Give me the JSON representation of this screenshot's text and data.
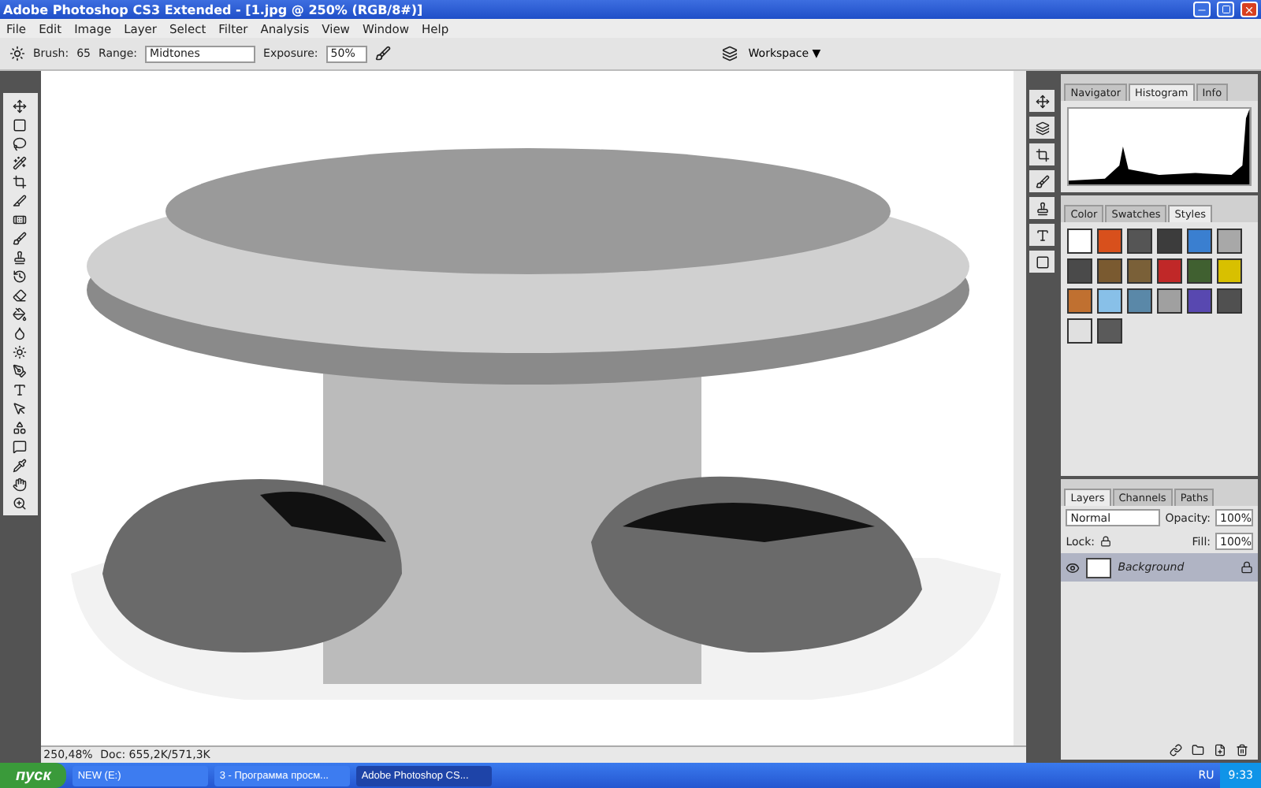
{
  "window": {
    "title": "Adobe Photoshop CS3 Extended - [1.jpg @ 250% (RGB/8#)]"
  },
  "menu": [
    "File",
    "Edit",
    "Image",
    "Layer",
    "Select",
    "Filter",
    "Analysis",
    "View",
    "Window",
    "Help"
  ],
  "options_bar": {
    "brush_label": "Brush:",
    "brush_size": "65",
    "range_label": "Range:",
    "range": "Midtones",
    "exposure_label": "Exposure:",
    "exposure": "50%",
    "workspace": "Workspace ▼"
  },
  "panels": [
    {
      "tabs": [
        {
          "label": "Navigator",
          "selected": false
        },
        {
          "label": "Histogram",
          "selected": true
        },
        {
          "label": "Info",
          "selected": false
        }
      ],
      "kind": "histogram"
    },
    {
      "tabs": [
        {
          "label": "Color",
          "selected": false
        },
        {
          "label": "Swatches",
          "selected": false
        },
        {
          "label": "Styles",
          "selected": true
        }
      ],
      "kind": "styles",
      "styles": [
        {
          "color": "#ffffff"
        },
        {
          "color": "#d8501c"
        },
        {
          "color": "#555555"
        },
        {
          "color": "#3c3c3c"
        },
        {
          "color": "#3a7fd0"
        },
        {
          "color": "#a8a8a8"
        },
        {
          "color": "#4a4a4a"
        },
        {
          "color": "#7a5a30"
        },
        {
          "color": "#7a6038"
        },
        {
          "color": "#c02828"
        },
        {
          "color": "#406030"
        },
        {
          "color": "#d8c000"
        },
        {
          "color": "#c07030"
        },
        {
          "color": "#88c0e8"
        },
        {
          "color": "#5a88a8"
        },
        {
          "color": "#a0a0a0"
        },
        {
          "color": "#5848b0"
        },
        {
          "color": "#505050"
        },
        {
          "color": "#e0e0e0"
        },
        {
          "color": "#5a5a5a"
        }
      ]
    },
    {
      "tabs": [
        {
          "label": "Layers",
          "selected": true
        },
        {
          "label": "Channels",
          "selected": false
        },
        {
          "label": "Paths",
          "selected": false
        }
      ],
      "kind": "layers",
      "blend_mode": "Normal",
      "opacity_label": "Opacity:",
      "opacity": "100%",
      "lock_label": "Lock:",
      "fill_label": "Fill:",
      "fill": "100%",
      "layers": [
        {
          "name": "Background",
          "visible": true,
          "selected": true,
          "locked": true
        }
      ]
    }
  ],
  "status_bar": {
    "zoom": "250,48%",
    "doc": "Doc: 655,2K/571,3K"
  },
  "taskbar": {
    "start": "пуск",
    "tasks": [
      {
        "label": "NEW (E:)",
        "selected": false
      },
      {
        "label": "3 - Программа просм...",
        "selected": false
      },
      {
        "label": "Adobe Photoshop CS...",
        "selected": true
      }
    ],
    "language": "RU",
    "clock": "9:33"
  }
}
